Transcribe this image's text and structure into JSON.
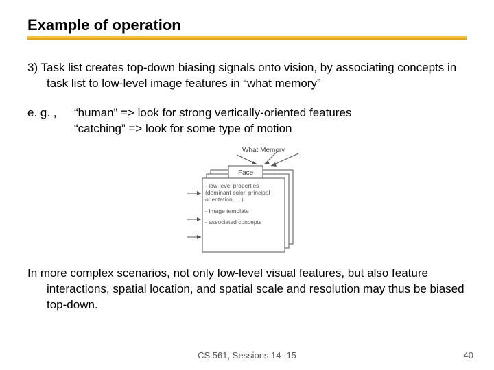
{
  "title": "Example of operation",
  "para1": "3) Task list creates top-down biasing signals onto vision, by associating concepts in task list to low-level image features in “what memory”",
  "eg_label": "e. g. ,",
  "eg_line1": "“human” => look for strong vertically-oriented features",
  "eg_line2": "“catching” => look for some type of motion",
  "diagram": {
    "top_label": "What Memory",
    "card_title": "Face",
    "bullet1": "- low-level properties (dominant color, principal orientation, …)",
    "bullet2": "- Image template",
    "bullet3": "- associated concepts"
  },
  "para2": "In more complex scenarios, not only low-level visual features, but also feature interactions, spatial location, and spatial scale and resolution may thus be biased top-down.",
  "footer": "CS 561,  Sessions 14 -15",
  "page": "40"
}
